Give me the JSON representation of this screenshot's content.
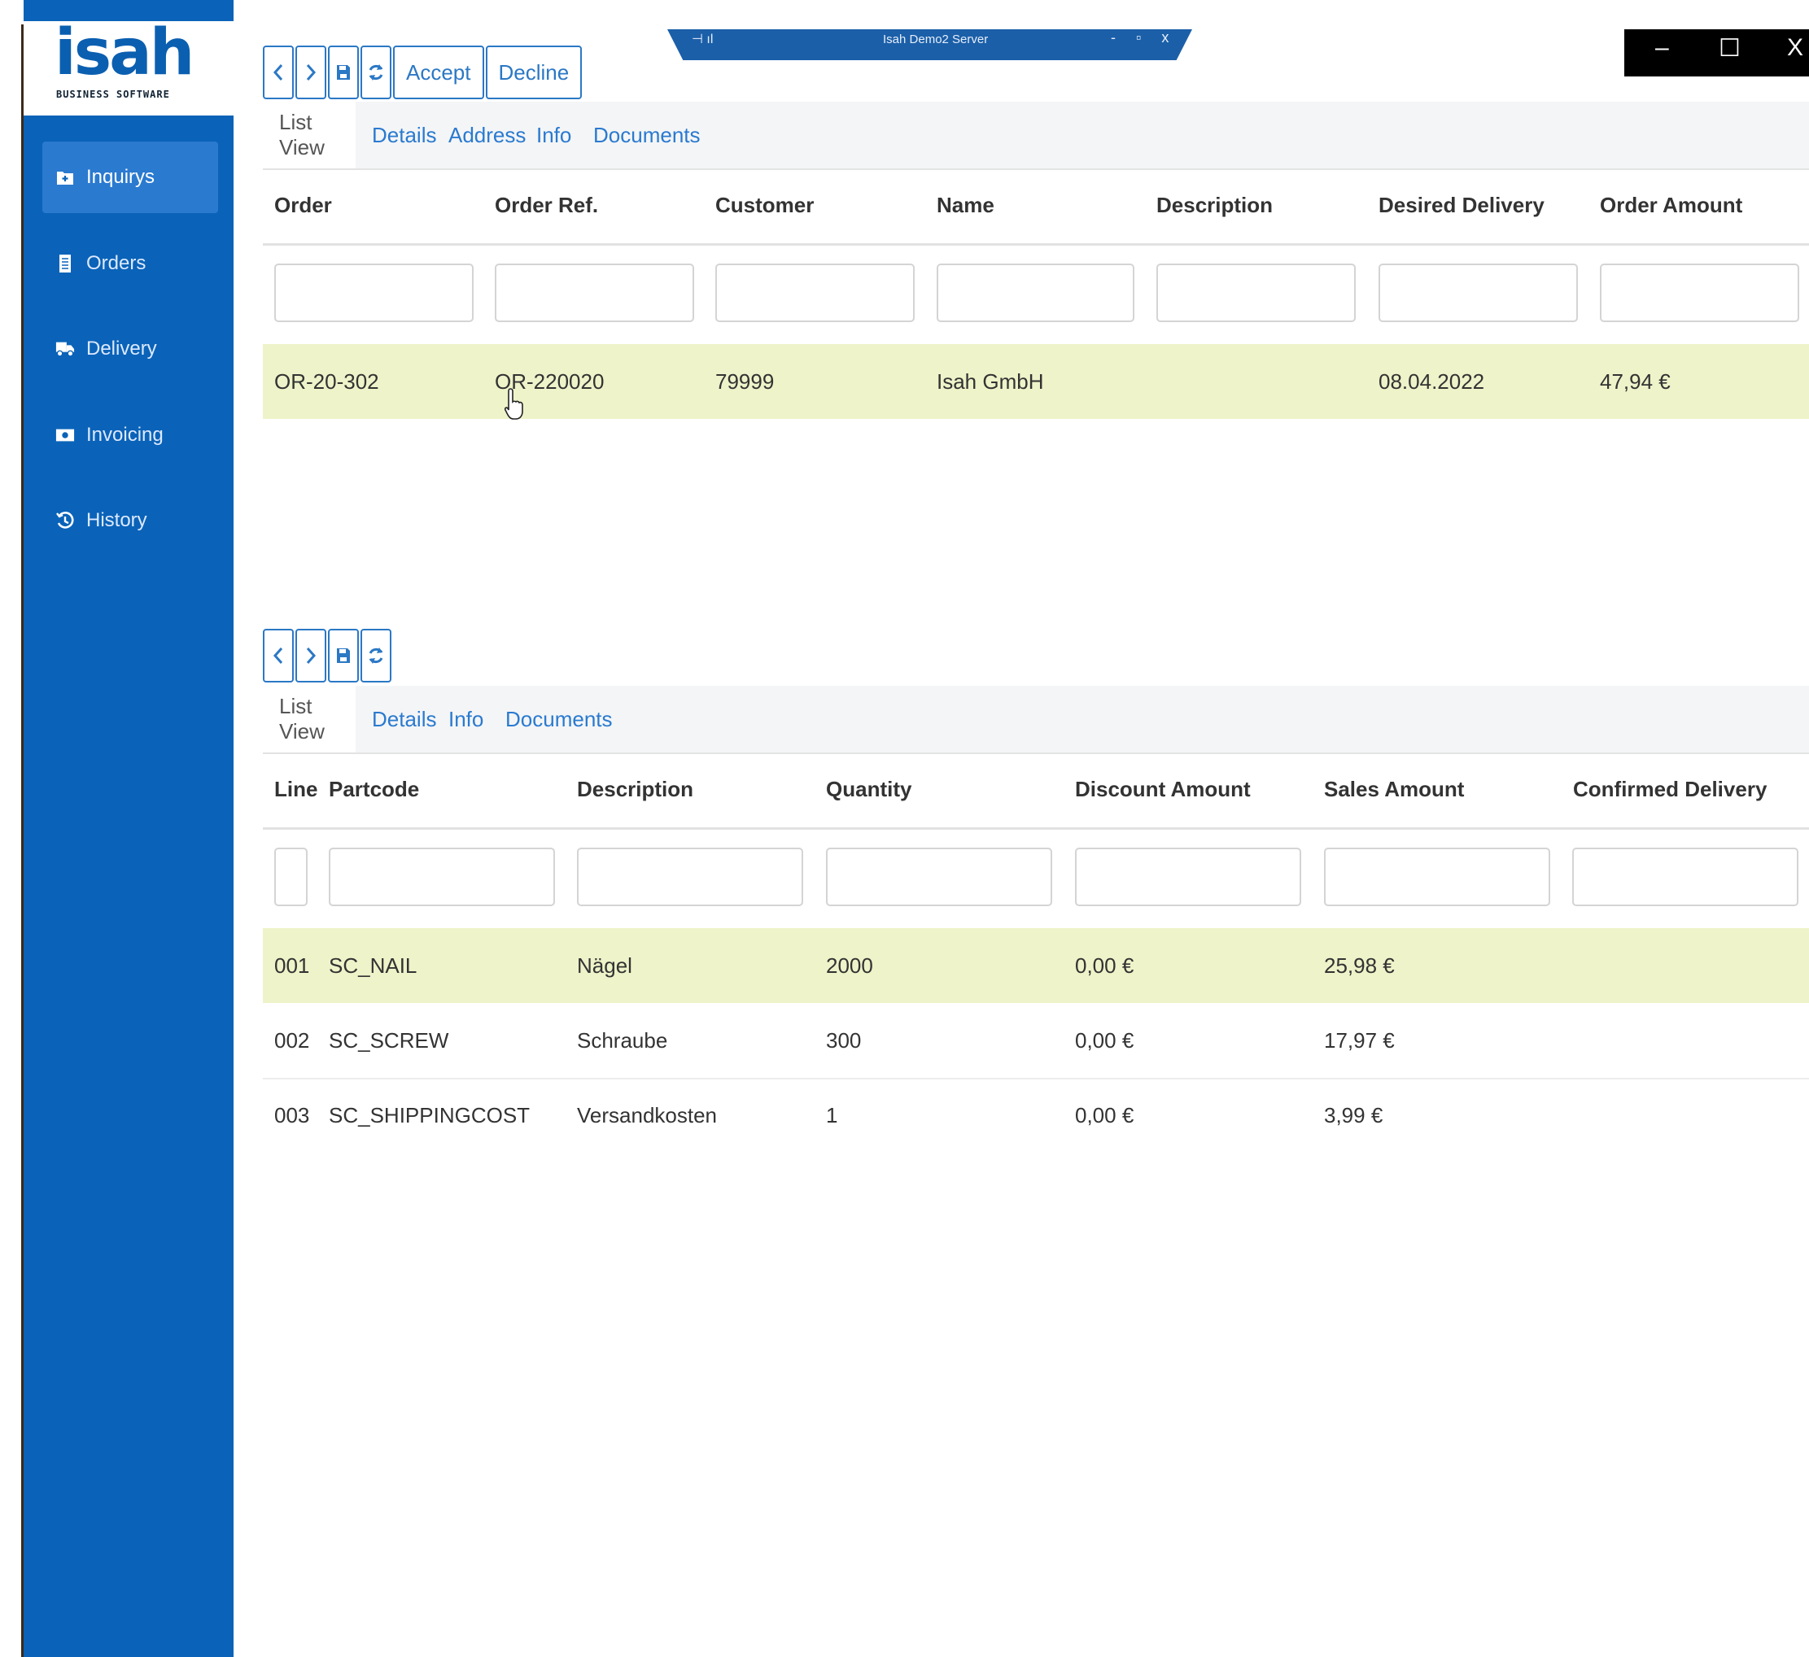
{
  "app": {
    "logo": "isah",
    "logo_subtitle": "BUSINESS SOFTWARE",
    "window_title": "Isah Demo2 Server",
    "window_controls": [
      "–",
      "☐",
      "X"
    ],
    "colors": {
      "sidebar": "#0a63b8",
      "accent": "#2b78c5",
      "selected_row": "#eef3c9"
    }
  },
  "sidebar": {
    "items": [
      {
        "label": "Inquirys",
        "icon": "plus-folder-icon",
        "active": true
      },
      {
        "label": "Orders",
        "icon": "document-icon",
        "active": false
      },
      {
        "label": "Delivery",
        "icon": "truck-icon",
        "active": false
      },
      {
        "label": "Invoicing",
        "icon": "money-icon",
        "active": false
      },
      {
        "label": "History",
        "icon": "history-icon",
        "active": false
      }
    ]
  },
  "orders_panel": {
    "toolbar": {
      "prev_icon": "chevron-left-icon",
      "next_icon": "chevron-right-icon",
      "save_icon": "save-icon",
      "refresh_icon": "refresh-icon",
      "accept": "Accept",
      "decline": "Decline"
    },
    "tabs": [
      "List View",
      "Details",
      "Address",
      "Info",
      "Documents"
    ],
    "active_tab": "List View",
    "columns": [
      "Order",
      "Order Ref.",
      "Customer",
      "Name",
      "Description",
      "Desired Delivery",
      "Order Amount"
    ],
    "rows": [
      {
        "order": "OR-20-302",
        "order_ref": "OR-220020",
        "customer": "79999",
        "name": "Isah GmbH",
        "description": "",
        "desired_delivery": "08.04.2022",
        "order_amount": "47,94 €",
        "selected": true
      }
    ]
  },
  "lines_panel": {
    "toolbar": {
      "prev_icon": "chevron-left-icon",
      "next_icon": "chevron-right-icon",
      "save_icon": "save-icon",
      "refresh_icon": "refresh-icon"
    },
    "tabs": [
      "List View",
      "Details",
      "Info",
      "Documents"
    ],
    "active_tab": "List View",
    "columns": [
      "Line",
      "Partcode",
      "Description",
      "Quantity",
      "Discount Amount",
      "Sales Amount",
      "Confirmed Delivery"
    ],
    "rows": [
      {
        "line": "001",
        "partcode": "SC_NAIL",
        "description": "Nägel",
        "quantity": "2000",
        "discount": "0,00 €",
        "sales": "25,98 €",
        "confirmed": "",
        "selected": true
      },
      {
        "line": "002",
        "partcode": "SC_SCREW",
        "description": "Schraube",
        "quantity": "300",
        "discount": "0,00 €",
        "sales": "17,97 €",
        "confirmed": "",
        "selected": false
      },
      {
        "line": "003",
        "partcode": "SC_SHIPPINGCOST",
        "description": "Versandkosten",
        "quantity": "1",
        "discount": "0,00 €",
        "sales": "3,99 €",
        "confirmed": "",
        "selected": false
      }
    ]
  }
}
